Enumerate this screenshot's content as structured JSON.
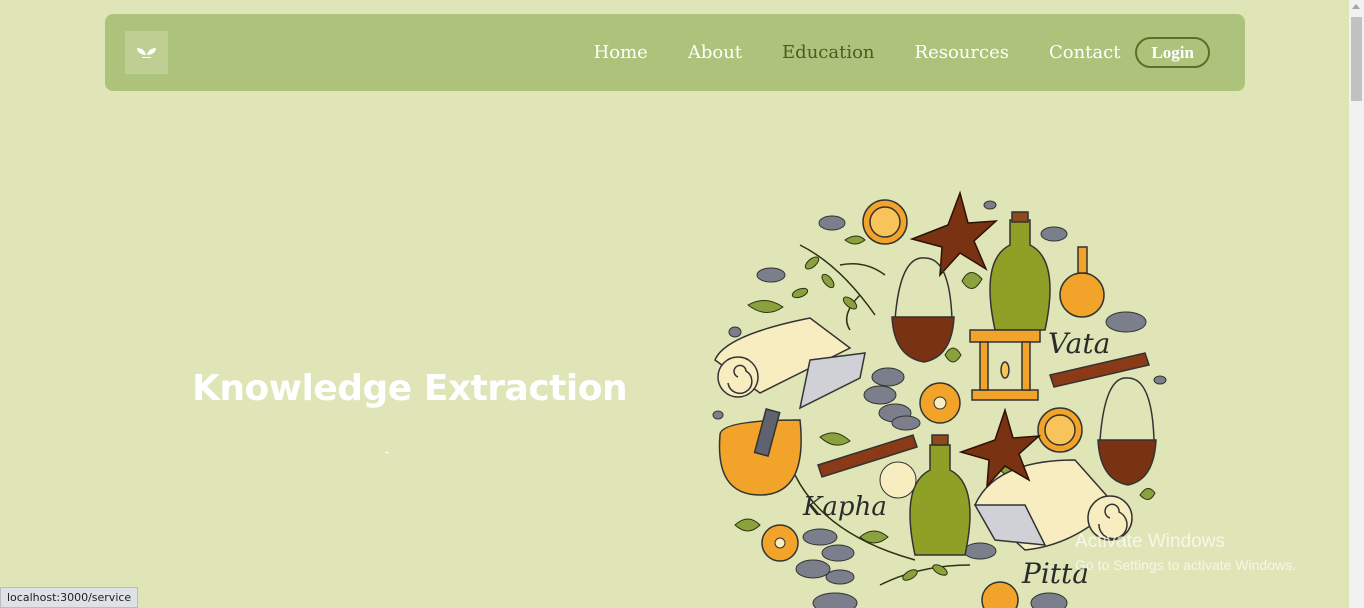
{
  "nav": {
    "items": [
      {
        "label": "Home",
        "active": false
      },
      {
        "label": "About",
        "active": false
      },
      {
        "label": "Education",
        "active": true
      },
      {
        "label": "Resources",
        "active": false
      },
      {
        "label": "Contact",
        "active": false
      }
    ],
    "login_label": "Login"
  },
  "hero": {
    "title": "Knowledge Extraction"
  },
  "illustration": {
    "labels": [
      "Vata",
      "Kapha",
      "Pitta"
    ]
  },
  "status_bar": {
    "url": "localhost:3000/service"
  },
  "watermark": {
    "line1": "Activate Windows",
    "line2": "Go to Settings to activate Windows."
  },
  "colors": {
    "background": "#dfe5b6",
    "navbar": "#adc37b",
    "active_link": "#4c5a26",
    "login_border": "#5a7024"
  }
}
